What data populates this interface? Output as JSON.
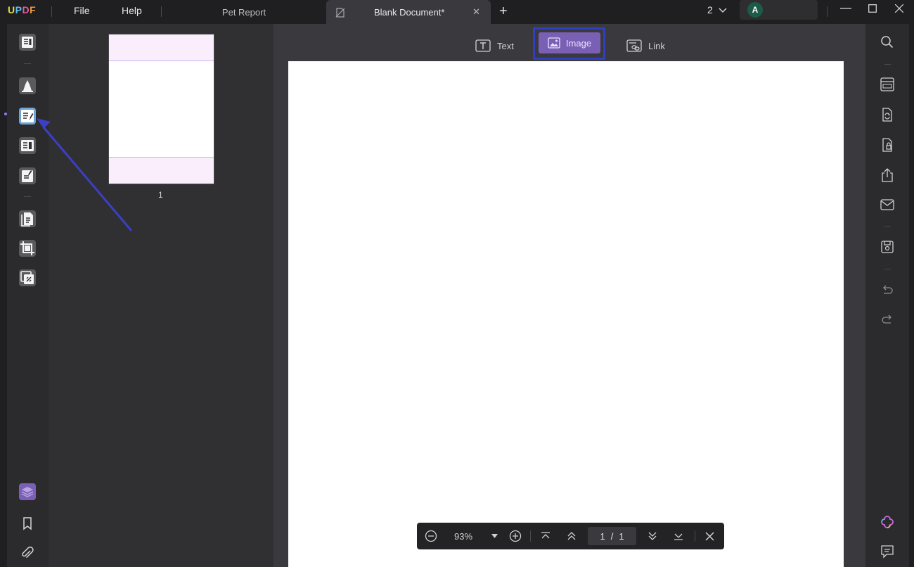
{
  "app": {
    "logo": {
      "u": "U",
      "p": "P",
      "d": "D",
      "f": "F"
    },
    "menu": {
      "file": "File",
      "help": "Help"
    }
  },
  "tabs": [
    {
      "label": "Pet Report",
      "active": false
    },
    {
      "label": "Blank Document*",
      "active": true
    }
  ],
  "tabbar": {
    "new_tab": "+",
    "close": "✕",
    "window_count": "2"
  },
  "account": {
    "avatar_initial": "A"
  },
  "edit_toolbar": {
    "text_label": "Text",
    "image_label": "Image",
    "link_label": "Link",
    "selected": "Image"
  },
  "thumbnails": [
    {
      "page_label": "1"
    }
  ],
  "zoom": {
    "level": "93%",
    "page_current": "1",
    "page_separator": "/",
    "page_total": "1"
  },
  "colors": {
    "accent_purple": "#7a60b4",
    "highlight_frame": "#2f3fbf",
    "annotation_arrow": "#3b3fc4",
    "background": "#1f1f22"
  },
  "icons": {
    "left": [
      "reader-icon",
      "comment-icon",
      "edit-pdf-icon",
      "organize-pages-icon",
      "prepare-form-icon",
      "convert-icon",
      "crop-icon",
      "watermark-icon",
      "layers-icon",
      "bookmark-icon",
      "attachment-icon"
    ],
    "right": [
      "search-icon",
      "ocr-icon",
      "convert-pdf-icon",
      "protect-icon",
      "share-icon",
      "email-icon",
      "save-icon",
      "undo-icon",
      "redo-icon",
      "ai-assistant-icon",
      "chat-icon"
    ]
  }
}
